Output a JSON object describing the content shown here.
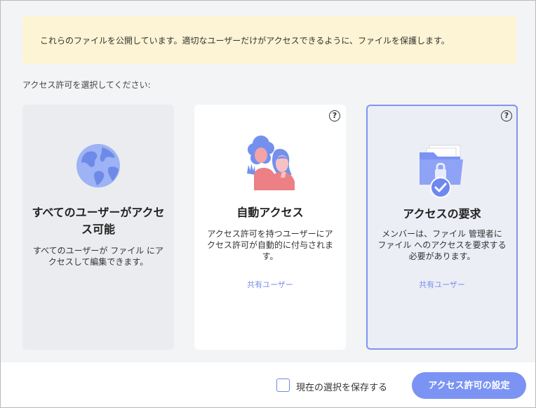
{
  "banner": {
    "text": "これらのファイルを公開しています。適切なユーザーだけがアクセスできるように、ファイルを保護します。"
  },
  "prompt": "アクセス許可を選択してください:",
  "cards": [
    {
      "title": "すべてのユーザーがアクセス可能",
      "description": "すべてのユーザーが ファイル にアクセスして編集できます。",
      "icon": "globe-icon",
      "selected": false
    },
    {
      "title": "自動アクセス",
      "description": "アクセス許可を持つユーザーにアクセス許可が自動的に付与されます。",
      "link": "共有ユーザー",
      "help": "?",
      "icon": "users-icon",
      "selected": false
    },
    {
      "title": "アクセスの要求",
      "description": "メンバーは、ファイル 管理者に ファイル へのアクセスを要求する必要があります。",
      "link": "共有ユーザー",
      "help": "?",
      "icon": "locked-folder-icon",
      "selected": true
    }
  ],
  "footer": {
    "save_selection_label": "現在の選択を保存する",
    "save_selection_checked": false,
    "primary_button": "アクセス許可の設定"
  },
  "colors": {
    "accent": "#7b93f3",
    "banner_bg": "#fcf4d4",
    "selected_border": "#7f95ef",
    "link": "#7a8fe6"
  }
}
